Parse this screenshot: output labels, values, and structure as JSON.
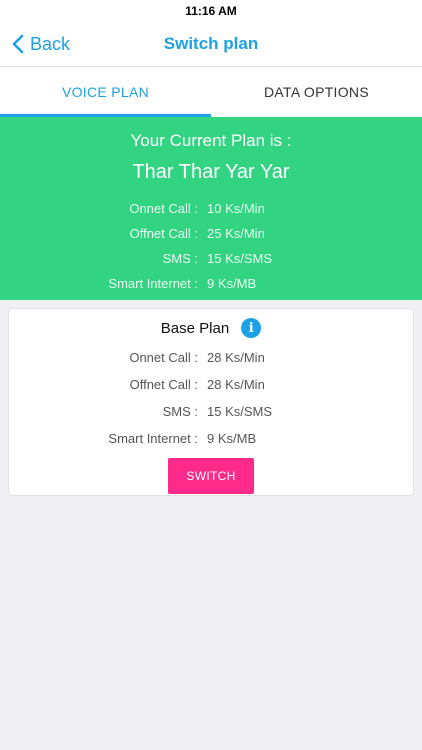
{
  "status": {
    "time": "11:16 AM"
  },
  "nav": {
    "back_label": "Back",
    "title": "Switch plan"
  },
  "tabs": [
    {
      "label": "VOICE PLAN",
      "active": true
    },
    {
      "label": "DATA OPTIONS",
      "active": false
    }
  ],
  "current_plan": {
    "heading": "Your Current Plan is :",
    "name": "Thar Thar Yar Yar",
    "rates": [
      {
        "label": "Onnet Call :",
        "value": "10 Ks/Min"
      },
      {
        "label": "Offnet Call :",
        "value": "25 Ks/Min"
      },
      {
        "label": "SMS :",
        "value": "15 Ks/SMS"
      },
      {
        "label": "Smart Internet :",
        "value": "9 Ks/MB"
      }
    ]
  },
  "base_plan": {
    "title": "Base Plan",
    "info_glyph": "i",
    "rates": [
      {
        "label": "Onnet Call :",
        "value": "28 Ks/Min"
      },
      {
        "label": "Offnet Call :",
        "value": "28 Ks/Min"
      },
      {
        "label": "SMS :",
        "value": "15 Ks/SMS"
      },
      {
        "label": "Smart Internet :",
        "value": "9 Ks/MB"
      }
    ],
    "switch_label": "SWITCH"
  },
  "colors": {
    "accent": "#1da1e6",
    "current_plan_bg": "#32d482",
    "switch_button": "#ff2a8a",
    "page_bg": "#efeff4"
  }
}
